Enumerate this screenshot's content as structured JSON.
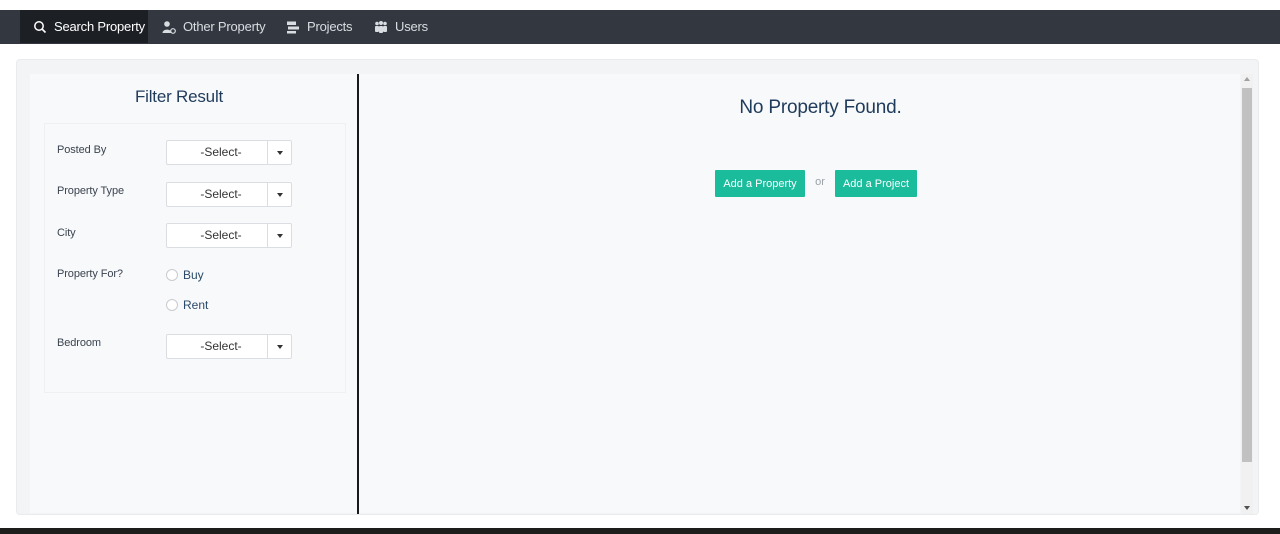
{
  "nav": {
    "items": [
      {
        "label": "Search Property",
        "icon": "search-icon",
        "active": true
      },
      {
        "label": "Other Property",
        "icon": "user-key-icon",
        "active": false
      },
      {
        "label": "Projects",
        "icon": "projects-icon",
        "active": false
      },
      {
        "label": "Users",
        "icon": "users-icon",
        "active": false
      }
    ]
  },
  "filter": {
    "title": "Filter Result",
    "posted_by": {
      "label": "Posted By",
      "value": "-Select-"
    },
    "property_type": {
      "label": "Property Type",
      "value": "-Select-"
    },
    "city": {
      "label": "City",
      "value": "-Select-"
    },
    "property_for": {
      "label": "Property For?",
      "options": [
        "Buy",
        "Rent"
      ]
    },
    "bedroom": {
      "label": "Bedroom",
      "value": "-Select-"
    }
  },
  "results": {
    "empty_message": "No Property Found.",
    "add_property_label": "Add a Property",
    "or_label": "or",
    "add_project_label": "Add a Project"
  },
  "colors": {
    "navbar": "#333840",
    "nav_active": "#1c1f24",
    "accent": "#1abc9c",
    "title_text": "#1f3b5c"
  }
}
